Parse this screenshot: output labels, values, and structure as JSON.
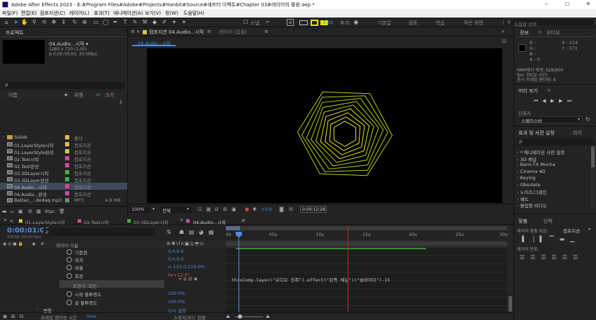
{
  "window": {
    "title": "Adobe After Effects 2023 - E:#Program Files#Adobe#Projects#Hanbit#Source#애프터 이펙트#Chapter 03#레이어의 활용.aep *",
    "controls": [
      "–",
      "☐",
      "✕"
    ]
  },
  "menu": [
    "파일(F)",
    "편집(E)",
    "컴포지션(C)",
    "레이어(L)",
    "효과(T)",
    "애니메이션(A)",
    "보기(V)",
    "창(W)",
    "도움말(H)"
  ],
  "toolbar": {
    "stroke_px": "3 px",
    "add_label": "추가:",
    "workspaces": [
      "기본값",
      "검토",
      "학습",
      "작은 화면"
    ],
    "search_placeholder": "도움말 검색"
  },
  "project": {
    "tab": "프로젝트",
    "selected_name": "04.Audio...시작 ▾",
    "selected_info1": "1280 x 720 (1.00)",
    "selected_info2": "Δ 0;00;30;00, 30.00fps",
    "search_placeholder": "ρ",
    "col_name": "이름",
    "col_type": "유형",
    "col_size": "크기",
    "bpc": "8bpc",
    "items": [
      {
        "name": "Solids",
        "type": "폴더",
        "color": "#e0c040",
        "size": ""
      },
      {
        "name": "01.LayerStyle시작",
        "type": "컴포지션",
        "color": "#e0c040",
        "size": ""
      },
      {
        "name": "01.LayerStyle완성",
        "type": "컴포지션",
        "color": "#e0c040",
        "size": ""
      },
      {
        "name": "02.Text시작",
        "type": "컴포지션",
        "color": "#d04aa0",
        "size": ""
      },
      {
        "name": "02.Text완성",
        "type": "컴포지션",
        "color": "#d04aa0",
        "size": ""
      },
      {
        "name": "03.3DLayer시작",
        "type": "컴포지션",
        "color": "#40b040",
        "size": ""
      },
      {
        "name": "03.3DLayer완성",
        "type": "컴포지션",
        "color": "#40b040",
        "size": ""
      },
      {
        "name": "04.Audio...시작",
        "type": "컴포지션",
        "color": "#d04aa0",
        "size": ""
      },
      {
        "name": "04.Audio...완성",
        "type": "컴포지션",
        "color": "#d04aa0",
        "size": ""
      },
      {
        "name": "Balzan_...dodaq.mp3",
        "type": "MP3",
        "color": "#7f7f7f",
        "size": "4.8 MB"
      }
    ]
  },
  "comp": {
    "tab_label": "컴포지션 04.Audio...시작",
    "layer_tab": "레이어 (없음)",
    "breadcrumb": "04.Audio...시작",
    "zoom": "100%",
    "resolution": "전체",
    "exposure": "+0.0",
    "timecode": "0:00:12:28"
  },
  "info": {
    "tab": "정보",
    "tab2": "오디오",
    "r": "R :",
    "g": "G :",
    "b": "B :",
    "a": "A : 0",
    "x": "X : 214",
    "y": "Y : 571",
    "ram1": "RAM에서 재생: 628/900",
    "ram2": "fps: 30(실 시간)",
    "ram3": "음시 프레임 렌더링: 8"
  },
  "preview": {
    "tab": "미리 보기",
    "shortcut_label": "단축키",
    "shortcut_value": "스페이스바"
  },
  "effects": {
    "tab": "효과 및 사전 설정",
    "tab2": "라이",
    "search_placeholder": "ρ",
    "items": [
      "* 애니메이션 사전 설정",
      "3D 채널",
      "Boris FX Mocha",
      "Cinema 4D",
      "Keying",
      "Obsolete",
      "노이즈/그레인",
      "매트",
      "몰입형 비디오"
    ]
  },
  "align": {
    "tab": "맞춤",
    "tab2": "단락",
    "align_to_label": "레이어 맞춤 대상:",
    "align_to_value": "컴포지션",
    "distribute_label": "레이어 분포:"
  },
  "timeline": {
    "tabs": [
      "01.LayerStyle시작",
      "02.Text시작",
      "03.3DLayer시작",
      "04.Audio...시작"
    ],
    "tab_colors": [
      "#e0c040",
      "#d04aa0",
      "#40b040",
      "#d04aa0"
    ],
    "current_time": "0:00:01:08",
    "current_frames": "00038 (30.00 fps)",
    "layer_name_col": "레이어 이름",
    "ruler": [
      "0s",
      "05s",
      "10s",
      "15s",
      "20s",
      "25s",
      "30s"
    ],
    "props": [
      {
        "name": "기준점",
        "value": "0.0,0.0"
      },
      {
        "name": "위치",
        "value": "0.0,0.0"
      },
      {
        "name": "비율",
        "value": "∞ 110.0,110.0%"
      },
      {
        "name": "회전",
        "value": "0x+12.5°"
      },
      {
        "name": "표현식: 회전",
        "value": ""
      },
      {
        "name": "시작 불투명도",
        "value": "100.0%"
      },
      {
        "name": "끝 불투명도",
        "value": "100.0%"
      },
      {
        "name": "변형",
        "value": "다시 설정"
      }
    ],
    "expression": "thisComp.layer(\"오디오 진폭\").effect(\"왼쪽 채널\")(\"슬라이더\")-15",
    "footer_left": "프레임 렌더링 시간",
    "footer_value": "0ms",
    "footer_mid": "스위치/모드 전환"
  }
}
